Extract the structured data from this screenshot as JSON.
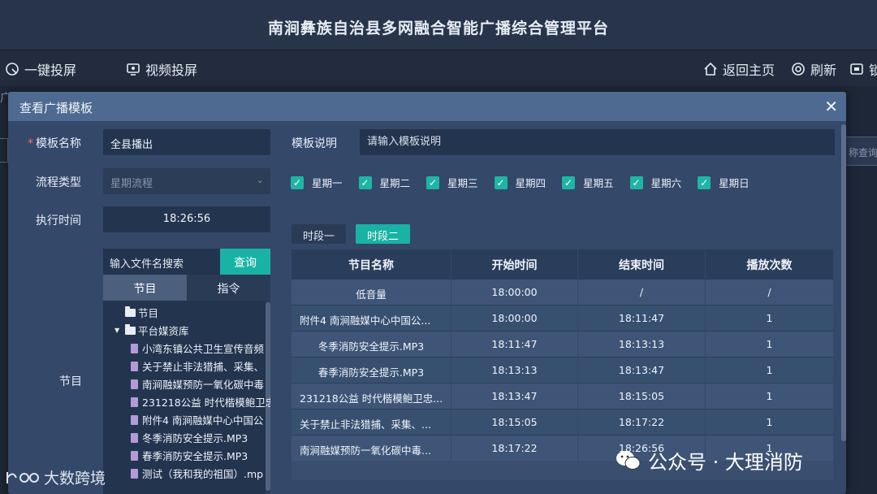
{
  "app": {
    "title": "南涧彝族自治县多网融合智能广播综合管理平台"
  },
  "toolbar": {
    "cast_screen": "一键投屏",
    "video_cast": "视频投屏",
    "home": "返回主页",
    "refresh": "刷新",
    "lock": "锁"
  },
  "background": {
    "left_fragment": "广",
    "right_fragment": "称查询"
  },
  "modal": {
    "title": "查看广播模板",
    "close_glyph": "✕",
    "template_name_label": "模板名称",
    "template_name_value": "全县播出",
    "template_desc_label": "模板说明",
    "template_desc_placeholder": "请输入模板说明",
    "flow_type_label": "流程类型",
    "flow_type_value": "星期流程",
    "exec_time_label": "执行时间",
    "exec_time_value": "18:26:56",
    "program_label": "节目",
    "weekdays": [
      "星期一",
      "星期二",
      "星期三",
      "星期四",
      "星期五",
      "星期六",
      "星期日"
    ],
    "period_tabs": [
      "时段一",
      "时段二"
    ],
    "file_search_placeholder": "输入文件名搜索",
    "search_button": "查询",
    "left_tabs": [
      "节目",
      "指令"
    ],
    "tree": [
      {
        "label": "节目",
        "type": "folder",
        "level": 0
      },
      {
        "label": "平台媒资库",
        "type": "folder-open",
        "level": 0
      },
      {
        "label": "小湾东镇公共卫生宣传音频",
        "type": "file",
        "level": 1
      },
      {
        "label": "关于禁止非法猎捕、采集、",
        "type": "file",
        "level": 1
      },
      {
        "label": "南涧融媒预防一氧化碳中毒",
        "type": "file",
        "level": 1
      },
      {
        "label": "231218公益 时代楷模鲍卫忠",
        "type": "file",
        "level": 1
      },
      {
        "label": "附件4 南涧融媒中心中国公",
        "type": "file",
        "level": 1
      },
      {
        "label": "冬季消防安全提示.MP3",
        "type": "file",
        "level": 1
      },
      {
        "label": "春季消防安全提示.MP3",
        "type": "file",
        "level": 1
      },
      {
        "label": "测试（我和我的祖国）.mp",
        "type": "file",
        "level": 1
      }
    ],
    "table": {
      "headers": [
        "节目名称",
        "开始时间",
        "结束时间",
        "播放次数"
      ],
      "rows": [
        [
          "低音量",
          "18:00:00",
          "/",
          "/"
        ],
        [
          "附件4 南涧融媒中心中国公...",
          "18:00:00",
          "18:11:47",
          "1"
        ],
        [
          "冬季消防安全提示.MP3",
          "18:11:47",
          "18:13:13",
          "1"
        ],
        [
          "春季消防安全提示.MP3",
          "18:13:13",
          "18:13:47",
          "1"
        ],
        [
          "231218公益 时代楷模鲍卫忠...",
          "18:13:47",
          "18:15:05",
          "1"
        ],
        [
          "关于禁止非法猎捕、采集、...",
          "18:15:05",
          "18:17:22",
          "1"
        ],
        [
          "南涧融媒预防一氧化碳中毒...",
          "18:17:22",
          "18:26:56",
          "1"
        ]
      ]
    }
  },
  "watermarks": {
    "left": "大数跨境",
    "right": "公众号 · 大理消防"
  },
  "colors": {
    "accent": "#19b3a5",
    "modal_bg": "#34486a",
    "header_bg": "#4e6a90"
  }
}
